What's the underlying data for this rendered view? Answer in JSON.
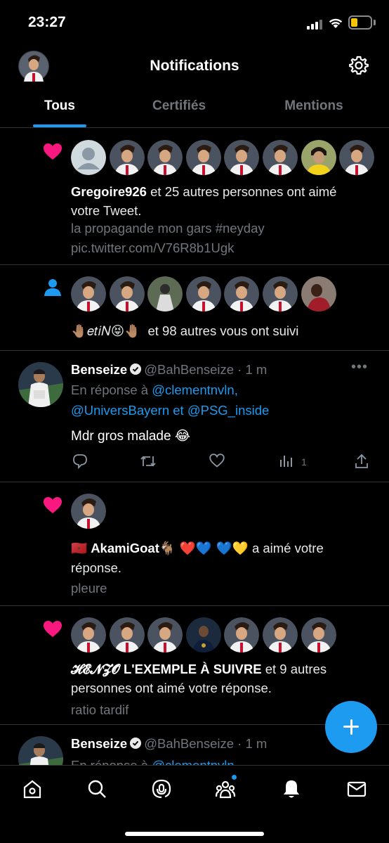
{
  "status_bar": {
    "time": "23:27"
  },
  "header": {
    "title": "Notifications"
  },
  "tabs": [
    {
      "label": "Tous"
    },
    {
      "label": "Certifiés"
    },
    {
      "label": "Mentions"
    }
  ],
  "notifications": [
    {
      "user": "Gregoire926",
      "text": " et 25 autres personnes ont aimé votre Tweet.",
      "tweet_text": "la propagande mon gars #neyday",
      "link": "pic.twitter.com/V76R8b1Ugk"
    },
    {
      "user_prefix": "🤚🏽",
      "user": "𝑒𝑡𝑖𝑁",
      "user_suffix": "😝🤚🏽",
      "text": "et 98 autres vous ont suivi"
    },
    {
      "name": "Benseize",
      "handle": "@BahBenseize",
      "time": " · 1 m",
      "reply_prefix": "En réponse à ",
      "reply_to_1": "@clementnvln,",
      "reply_to_2": "@UniversBayern",
      "reply_join": " et ",
      "reply_to_3": "@PSG_inside",
      "body": "Mdr gros malade 😂",
      "views_count": "1"
    },
    {
      "user_prefix": "🇲🇦",
      "user": "AkamiGoat",
      "user_suffix": "🐐 ❤️💙 💙💛",
      "text": "a aimé votre réponse.",
      "tweet_text": "pleure"
    },
    {
      "user": "𝓗𝓔𝓝𝓩𝓞 L'EXEMPLE À SUIVRE",
      "text": " et 9 autres personnes ont aimé votre réponse.",
      "tweet_text": "ratio tardif"
    },
    {
      "name": "Benseize",
      "handle": "@BahBenseize",
      "time": " · 1 m",
      "reply_prefix": "En réponse à ",
      "reply_to_1": "@clementnvln"
    }
  ],
  "colors": {
    "background": "#000000",
    "accent": "#1d9bf0",
    "like": "#f91880",
    "muted_text": "#71767b",
    "divider": "#2f3336",
    "battery": "#f7c600"
  },
  "icons": {
    "like": "heart-icon",
    "follow": "person-icon",
    "reply": "reply-icon",
    "retweet": "retweet-icon",
    "likes": "heart-outline-icon",
    "views": "views-icon",
    "share": "share-icon",
    "settings": "gear-icon",
    "compose": "plus-icon"
  }
}
